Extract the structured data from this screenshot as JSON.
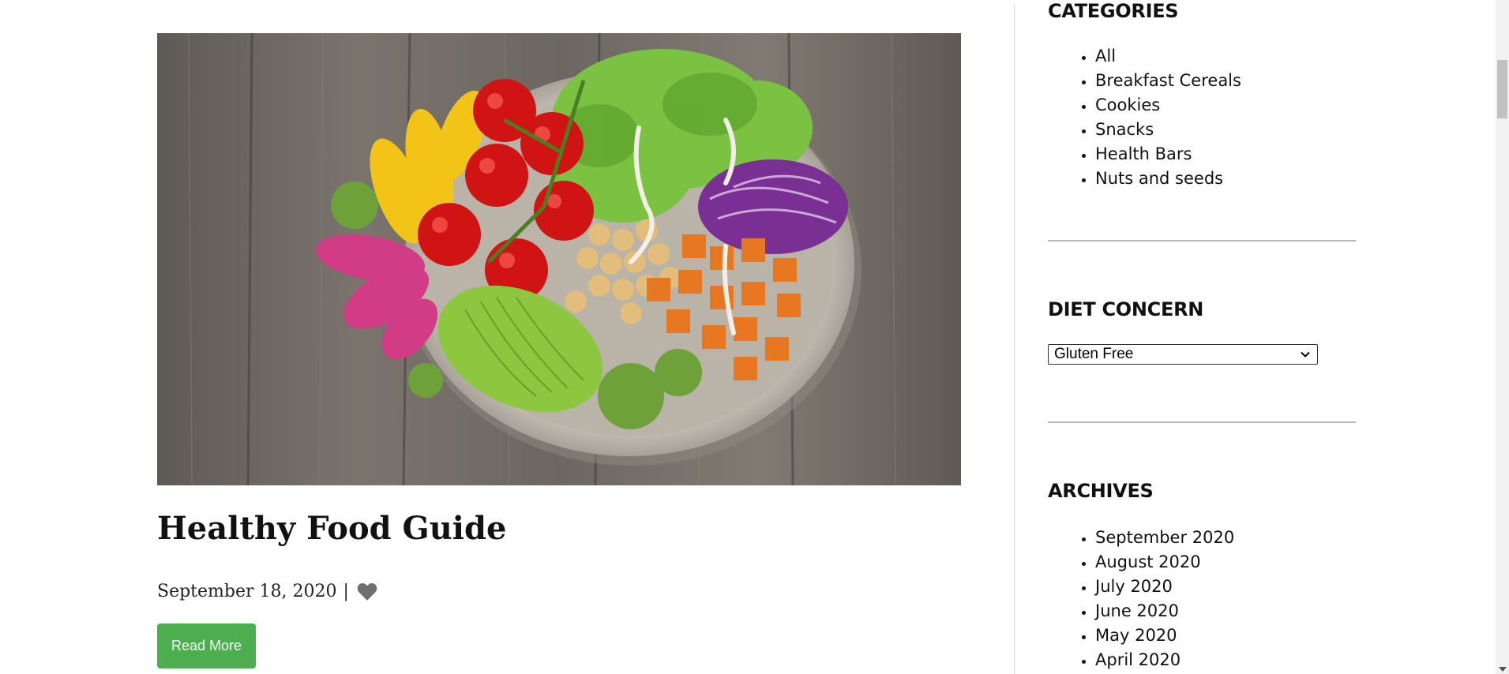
{
  "post": {
    "image_alt": "Salad bowl with tomatoes, peppers, lettuce, chickpeas, sweet potato, cabbage, radish and avocado",
    "title": "Healthy Food Guide",
    "date": "September 18, 2020",
    "separator": "|",
    "like_icon": "heart-icon",
    "read_more_label": "Read More"
  },
  "sidebar": {
    "categories": {
      "title": "CATEGORIES",
      "items": [
        "All",
        "Breakfast Cereals",
        "Cookies",
        "Snacks",
        "Health Bars",
        "Nuts and seeds"
      ]
    },
    "diet": {
      "title": "DIET CONCERN",
      "selected": "Gluten Free"
    },
    "archives": {
      "title": "ARCHIVES",
      "items": [
        "September 2020",
        "August 2020",
        "July 2020",
        "June 2020",
        "May 2020",
        "April 2020"
      ]
    }
  },
  "colors": {
    "accent": "#4cae4f",
    "heart": "#6f6f6f",
    "divider": "#d4d4d4"
  }
}
